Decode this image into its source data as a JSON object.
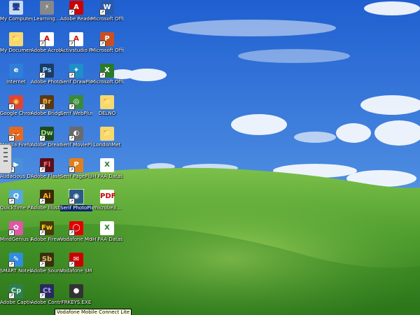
{
  "desktop": {
    "icons": [
      {
        "label": "My Computer",
        "glyph": "🖥",
        "color": "#c9d9f0",
        "text": "#1a3d8f",
        "shortcut": false,
        "icon_name": "my-computer-icon"
      },
      {
        "label": "My Documents",
        "glyph": "📁",
        "color": "#f5d870",
        "text": "#6a4d00",
        "shortcut": false,
        "icon_name": "my-documents-icon"
      },
      {
        "label": "Internet",
        "glyph": "e",
        "color": "#2f7fd8",
        "text": "#fff",
        "shortcut": false,
        "icon_name": "internet-explorer-icon"
      },
      {
        "label": "Google Chrome",
        "glyph": "◉",
        "color": "#e04534",
        "text": "#ffd43b",
        "shortcut": true,
        "icon_name": "chrome-icon"
      },
      {
        "label": "Mozilla Firefox",
        "glyph": "🦊",
        "color": "#e66a1e",
        "text": "#fff",
        "shortcut": true,
        "icon_name": "firefox-icon"
      },
      {
        "label": "Audacious DVD Suite",
        "glyph": "▶",
        "color": "#4a90d9",
        "text": "#fff",
        "shortcut": true,
        "icon_name": "dvd-suite-icon"
      },
      {
        "label": "QuickTime Player",
        "glyph": "Q",
        "color": "#57a7e0",
        "text": "#fff",
        "shortcut": true,
        "icon_name": "quicktime-icon"
      },
      {
        "label": "MindGenius Educatio...",
        "glyph": "✿",
        "color": "#e056a8",
        "text": "#fff",
        "shortcut": true,
        "icon_name": "mindgenius-icon"
      },
      {
        "label": "SMART Notebook 10",
        "glyph": "✎",
        "color": "#2f8de0",
        "text": "#fff",
        "shortcut": true,
        "icon_name": "smart-notebook-icon"
      },
      {
        "label": "Adobe Captivate 3",
        "glyph": "Cp",
        "color": "#2f7d54",
        "text": "#bff5cc",
        "shortcut": true,
        "icon_name": "captivate-icon"
      },
      {
        "label": "Learning...",
        "glyph": "⚡",
        "color": "#888",
        "text": "#fff",
        "shortcut": false,
        "icon_name": "learning-icon"
      },
      {
        "label": "Adobe Acrobat 9 Pro",
        "glyph": "A",
        "color": "#fff",
        "text": "#c00",
        "shortcut": true,
        "icon_name": "acrobat-icon"
      },
      {
        "label": "Adobe Photosh...",
        "glyph": "Ps",
        "color": "#1b3b66",
        "text": "#8ed1ff",
        "shortcut": true,
        "icon_name": "photoshop-icon"
      },
      {
        "label": "Adobe Bridge CS4",
        "glyph": "Br",
        "color": "#5a3a12",
        "text": "#f0b040",
        "shortcut": true,
        "icon_name": "bridge-icon"
      },
      {
        "label": "Adobe Dreamwea...",
        "glyph": "Dw",
        "color": "#1f4a1f",
        "text": "#9de07a",
        "shortcut": true,
        "icon_name": "dreamweaver-icon"
      },
      {
        "label": "Adobe Flash CS4 Prof...",
        "glyph": "Fl",
        "color": "#5a0f1a",
        "text": "#ff6a6a",
        "shortcut": true,
        "icon_name": "flash-icon"
      },
      {
        "label": "Adobe Illustrator CS4",
        "glyph": "Ai",
        "color": "#3a2a08",
        "text": "#ffb020",
        "shortcut": true,
        "icon_name": "illustrator-icon"
      },
      {
        "label": "Adobe Fireworks CS4",
        "glyph": "Fw",
        "color": "#4a3a08",
        "text": "#ffd020",
        "shortcut": true,
        "icon_name": "fireworks-icon"
      },
      {
        "label": "Adobe Soundbo...",
        "glyph": "Sb",
        "color": "#3a2e10",
        "text": "#e0c060",
        "shortcut": true,
        "icon_name": "soundbooth-icon"
      },
      {
        "label": "Adobe Contrib...",
        "glyph": "Ct",
        "color": "#2a2a5a",
        "text": "#a0a0ff",
        "shortcut": true,
        "icon_name": "contribute-icon"
      },
      {
        "label": "Adobe Reader 9",
        "glyph": "A",
        "color": "#c00",
        "text": "#fff",
        "shortcut": true,
        "icon_name": "adobe-reader-icon"
      },
      {
        "label": "Activstudio Professio...",
        "glyph": "A",
        "color": "#fff",
        "text": "#d01010",
        "shortcut": true,
        "icon_name": "activstudio-icon"
      },
      {
        "label": "Serif DrawPlus X3",
        "glyph": "✦",
        "color": "#1e8fc8",
        "text": "#fff",
        "shortcut": true,
        "icon_name": "drawplus-icon"
      },
      {
        "label": "Serif WebPlus X4",
        "glyph": "◎",
        "color": "#3a8a3a",
        "text": "#fff",
        "shortcut": true,
        "icon_name": "webplus-icon"
      },
      {
        "label": "Serif MoviePlus X4",
        "glyph": "◐",
        "color": "#6a6a6a",
        "text": "#fff",
        "shortcut": true,
        "icon_name": "movieplus-icon"
      },
      {
        "label": "Serif PagePlus X4",
        "glyph": "P",
        "color": "#e0801a",
        "text": "#fff",
        "shortcut": true,
        "icon_name": "pageplus-icon"
      },
      {
        "label": "Serif PhotoPlus X3",
        "glyph": "◉",
        "color": "#2a5a8a",
        "text": "#fff",
        "shortcut": true,
        "selected": true,
        "icon_name": "photoplus-icon"
      },
      {
        "label": "Vodafone Mobile ...",
        "glyph": "◯",
        "color": "#e00000",
        "text": "#fff",
        "shortcut": true,
        "icon_name": "vodafone-mobile-icon"
      },
      {
        "label": "Vodafone SMS",
        "glyph": "✉",
        "color": "#c00",
        "text": "#fff",
        "shortcut": true,
        "icon_name": "vodafone-sms-icon"
      },
      {
        "label": "FRKEYS.EXE",
        "glyph": "●",
        "color": "#333",
        "text": "#fff",
        "shortcut": false,
        "icon_name": "frkeys-icon"
      },
      {
        "label": "Microsoft Office W...",
        "glyph": "W",
        "color": "#2a5aa8",
        "text": "#fff",
        "shortcut": true,
        "icon_name": "word-icon"
      },
      {
        "label": "Microsoft Office Po...",
        "glyph": "P",
        "color": "#c85020",
        "text": "#fff",
        "shortcut": true,
        "icon_name": "powerpoint-icon"
      },
      {
        "label": "Microsoft Office Ex...",
        "glyph": "X",
        "color": "#2a7a2a",
        "text": "#fff",
        "shortcut": true,
        "icon_name": "excel-icon"
      },
      {
        "label": "DELNO",
        "glyph": "📁",
        "color": "#f5d870",
        "text": "#6a4d00",
        "shortcut": false,
        "icon_name": "folder-icon"
      },
      {
        "label": "LondonMet",
        "glyph": "📁",
        "color": "#f5d870",
        "text": "#6a4d00",
        "shortcut": false,
        "icon_name": "folder-icon"
      },
      {
        "label": "IH PAA Dataset.Ma...",
        "glyph": "X",
        "color": "#fff",
        "text": "#2a7a2a",
        "shortcut": false,
        "icon_name": "excel-file-icon"
      },
      {
        "label": "microbe3...",
        "glyph": "PDF",
        "color": "#fff",
        "text": "#c00",
        "shortcut": false,
        "icon_name": "pdf-file-icon"
      },
      {
        "label": "IH PAA Dataset.Ma...",
        "glyph": "X",
        "color": "#fff",
        "text": "#2a7a2a",
        "shortcut": false,
        "icon_name": "excel-file-icon"
      }
    ]
  },
  "tooltip": {
    "text": "Vodafone Mobile Connect Lite"
  },
  "colors": {
    "sky_top": "#1f5fd0",
    "sky_bottom": "#9cc7f2",
    "grass_top": "#5aa83a",
    "grass_bottom": "#2f7d1c",
    "selection": "#0a246a"
  }
}
